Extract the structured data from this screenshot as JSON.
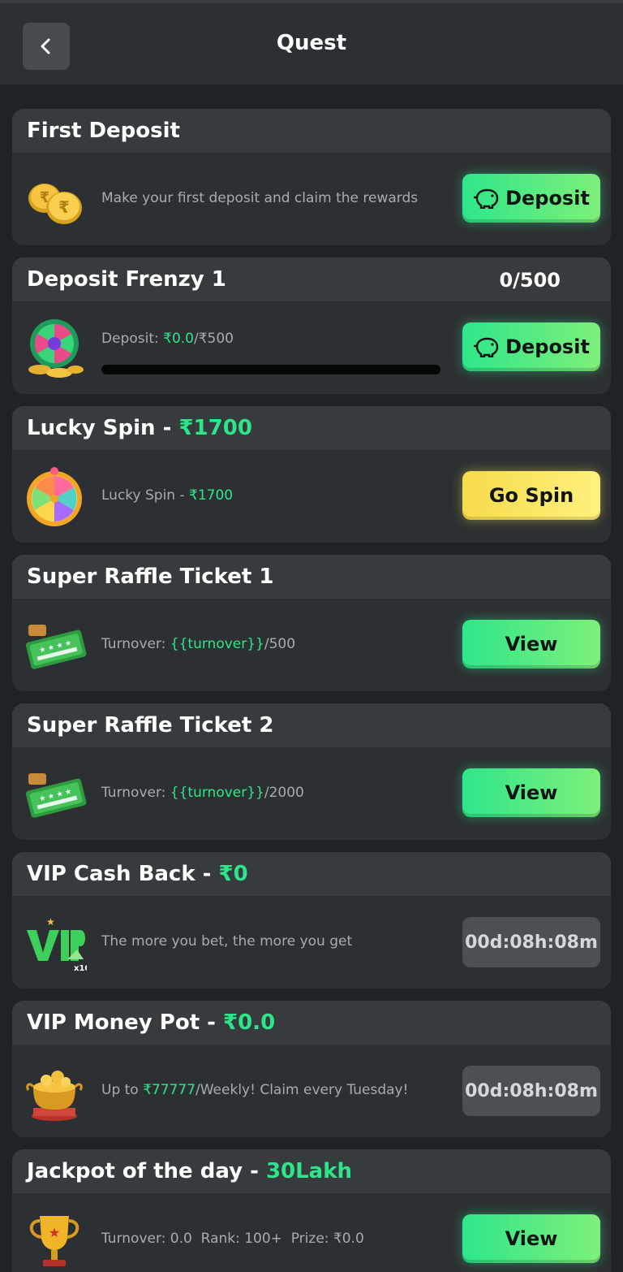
{
  "header": {
    "title": "Quest",
    "back_icon": "chevron-left-icon"
  },
  "cards": {
    "first_deposit": {
      "title": "First Deposit",
      "icon": "rupee-coins-icon",
      "description": "Make your first deposit and claim the rewards",
      "button": "Deposit",
      "button_icon": "piggy-bank-icon"
    },
    "deposit_frenzy": {
      "title": "Deposit Frenzy 1",
      "progress_text": "0/500",
      "icon": "prize-wheel-coins-icon",
      "desc_label": "Deposit: ",
      "desc_value": "₹0.0",
      "desc_total": "/₹500",
      "progress_fraction": 0,
      "button": "Deposit",
      "button_icon": "piggy-bank-icon"
    },
    "lucky_spin": {
      "title": "Lucky Spin - ",
      "title_amount": "₹1700",
      "icon": "spin-wheel-icon",
      "desc_label": "Lucky Spin - ",
      "desc_value": "₹1700",
      "button": "Go Spin"
    },
    "raffle_1": {
      "title": "Super Raffle Ticket 1",
      "icon": "raffle-ticket-icon",
      "desc_label": "Turnover: ",
      "desc_value": "{{turnover}}",
      "desc_total": "/500",
      "button": "View"
    },
    "raffle_2": {
      "title": "Super Raffle Ticket 2",
      "icon": "raffle-ticket-icon",
      "desc_label": "Turnover: ",
      "desc_value": "{{turnover}}",
      "desc_total": "/2000",
      "button": "View"
    },
    "vip_cashback": {
      "title": "VIP Cash Back - ",
      "title_amount": "₹0",
      "icon": "vip-badge-icon",
      "description": "The more you bet, the more you get",
      "timer": "00d:08h:08m"
    },
    "vip_money_pot": {
      "title": "VIP Money Pot - ",
      "title_amount": "₹0.0",
      "icon": "gold-pot-icon",
      "desc_label": "Up to ",
      "desc_value": "₹77777",
      "desc_total": "/Weekly! Claim every Tuesday!",
      "timer": "00d:08h:08m"
    },
    "jackpot": {
      "title": "Jackpot of the day - ",
      "title_amount": "30Lakh",
      "icon": "trophy-icon",
      "description": "Turnover: 0.0  Rank: 100+  Prize: ₹0.0",
      "button": "View"
    }
  },
  "colors": {
    "accent_green": "#2ee68a",
    "accent_yellow": "#f7dc4a",
    "card_bg": "#2c3032",
    "page_bg": "#202325"
  }
}
